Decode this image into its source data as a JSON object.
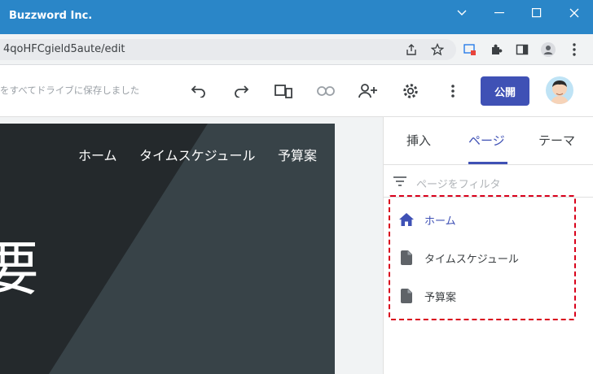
{
  "window": {
    "title": "Buzzword Inc."
  },
  "address": {
    "url": "4qoHFCgield5aute/edit"
  },
  "toolbar": {
    "saved_status": "をすべてドライブに保存しました",
    "publish_label": "公開"
  },
  "site_preview": {
    "nav": [
      "ホーム",
      "タイムスケジュール",
      "予算案"
    ],
    "hero_text": "要"
  },
  "panel": {
    "tabs": [
      "挿入",
      "ページ",
      "テーマ"
    ],
    "active_tab": "ページ",
    "filter_placeholder": "ページをフィルタ",
    "pages": [
      {
        "label": "ホーム",
        "icon": "home-icon",
        "active": true
      },
      {
        "label": "タイムスケジュール",
        "icon": "file-icon",
        "active": false
      },
      {
        "label": "予算案",
        "icon": "file-icon",
        "active": false
      }
    ]
  },
  "colors": {
    "titlebar": "#2a86c8",
    "accent": "#3f51b5",
    "highlight_border": "#d9001b"
  }
}
